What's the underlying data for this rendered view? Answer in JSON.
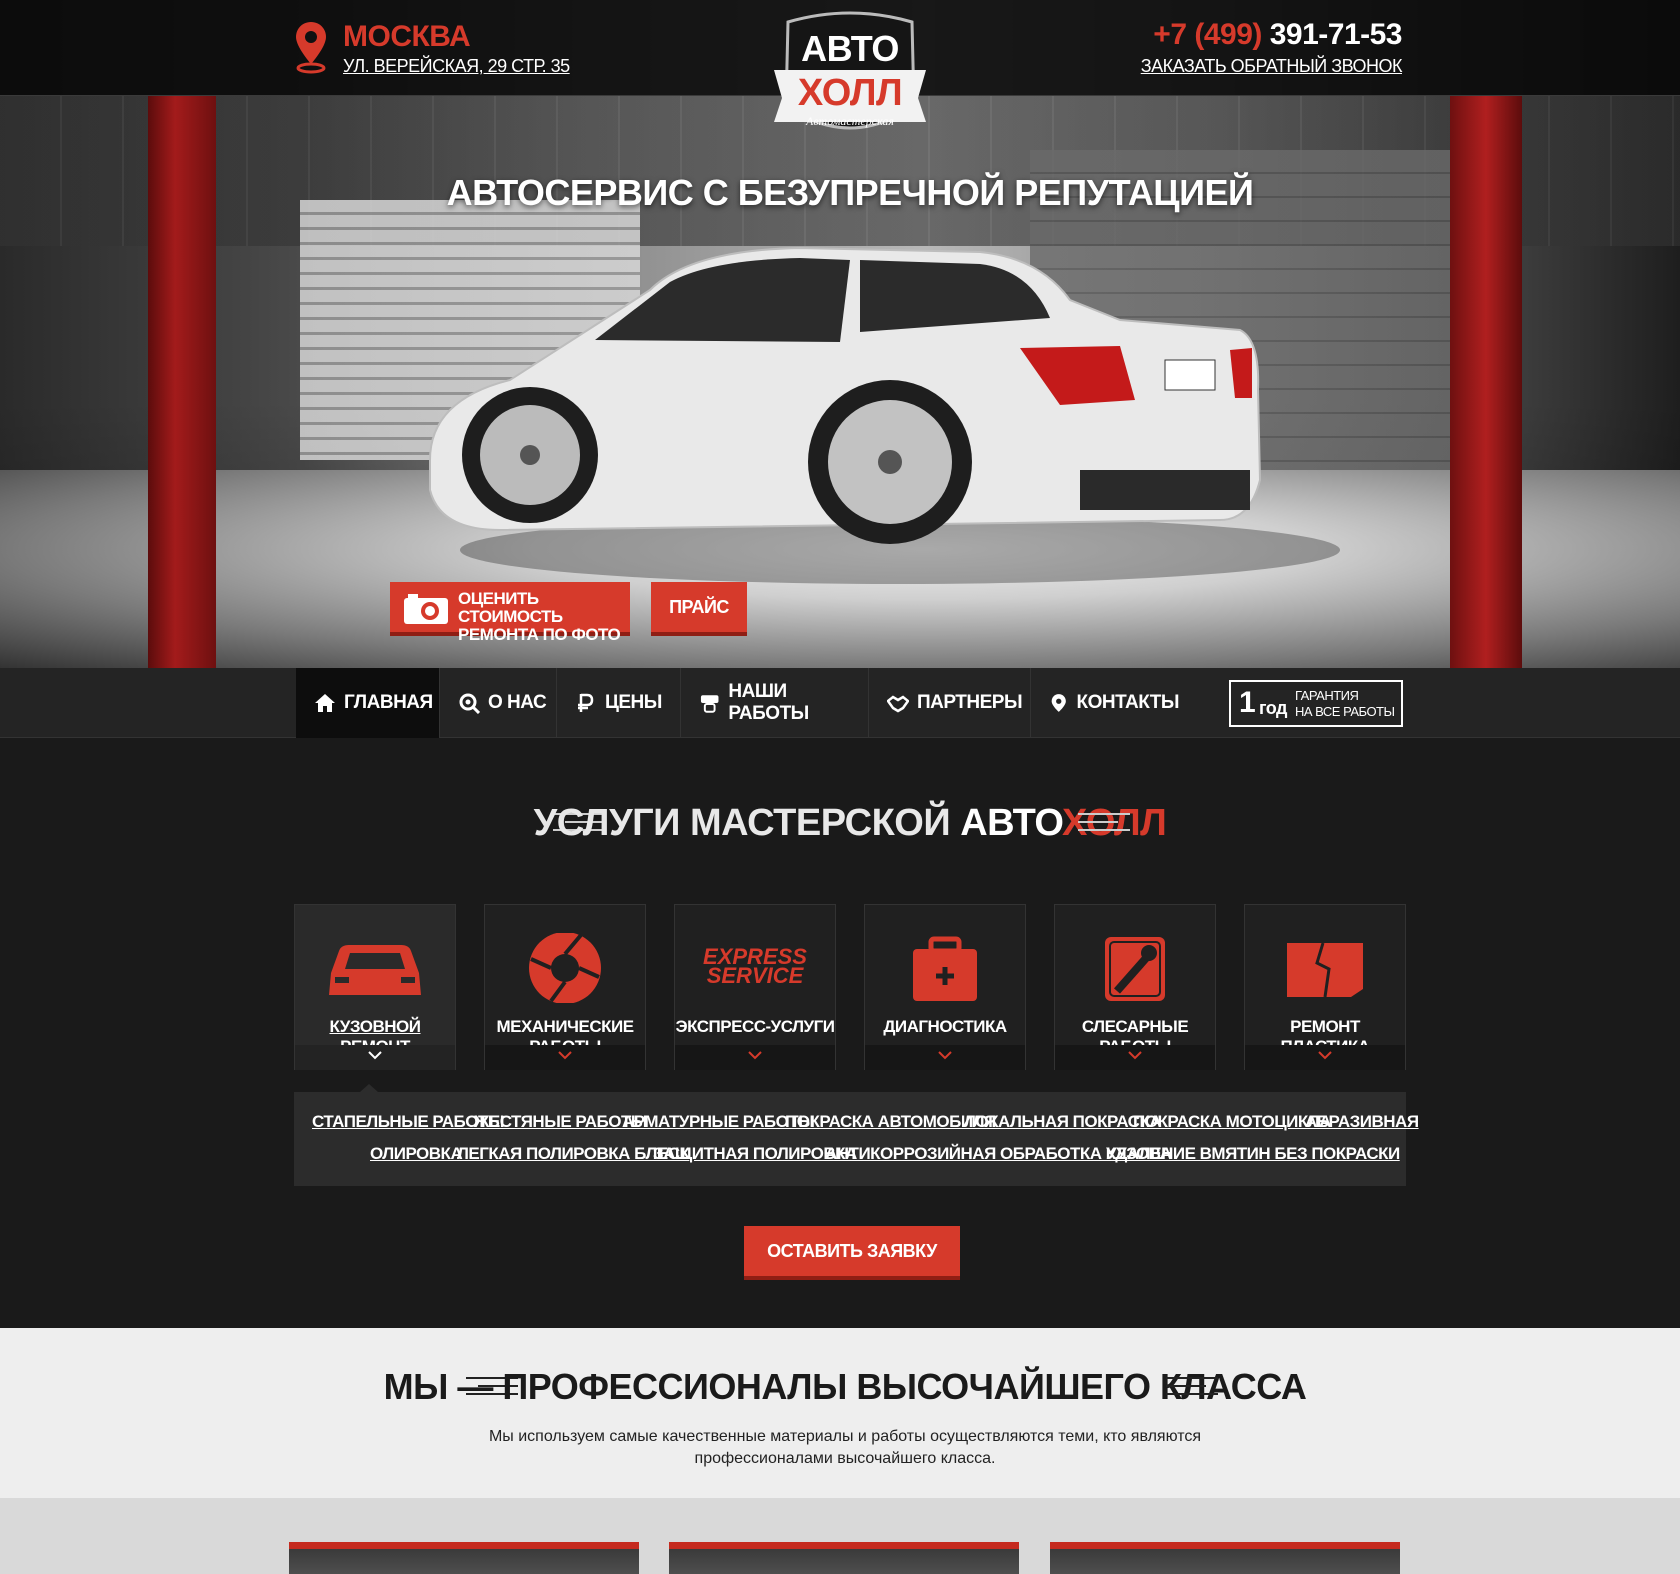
{
  "header": {
    "city": "МОСКВА",
    "address": "УЛ. ВЕРЕЙСКАЯ, 29 СТР. 35",
    "logo_line1": "АВТО",
    "logo_line2": "ХОЛЛ",
    "logo_line3": "Автомастерская",
    "phone_code": "+7 (499)",
    "phone_number": "391-71-53",
    "callback_label": "ЗАКАЗАТЬ ОБРАТНЫЙ ЗВОНОК"
  },
  "hero": {
    "title": "АВТОСЕРВИС С БЕЗУПРЕЧНОЙ РЕПУТАЦИЕЙ",
    "photo_button_line1": "ОЦЕНИТЬ СТОИМОСТЬ",
    "photo_button_line2": "РЕМОНТА ПО ФОТО",
    "price_button": "ПРАЙС"
  },
  "nav": {
    "items": [
      {
        "label": "ГЛАВНАЯ",
        "icon": "home-icon"
      },
      {
        "label": "О НАС",
        "icon": "search-gear-icon"
      },
      {
        "label": "ЦЕНЫ",
        "icon": "ruble-icon"
      },
      {
        "label": "НАШИ РАБОТЫ",
        "icon": "wheel-icon"
      },
      {
        "label": "ПАРТНЕРЫ",
        "icon": "handshake-icon"
      },
      {
        "label": "КОНТАКТЫ",
        "icon": "pin-icon"
      }
    ],
    "guarantee_number": "1",
    "guarantee_unit": "год",
    "guarantee_line1": "ГАРАНТИЯ",
    "guarantee_line2": "НА ВСЕ РАБОТЫ"
  },
  "services": {
    "title_part1": "УСЛУГИ МАСТЕРСКОЙ ",
    "title_part2": "АВТО",
    "title_part3": "ХОЛЛ",
    "cards": [
      {
        "label": "КУЗОВНОЙ РЕМОНТ",
        "icon": "car-icon"
      },
      {
        "label": "МЕХАНИЧЕСКИЕ РАБОТЫ",
        "icon": "gear-aperture-icon"
      },
      {
        "label": "ЭКСПРЕСС-УСЛУГИ",
        "icon": "express-service-icon"
      },
      {
        "label": "ДИАГНОСТИКА",
        "icon": "medkit-icon"
      },
      {
        "label": "СЛЕСАРНЫЕ РАБОТЫ",
        "icon": "wrench-icon"
      },
      {
        "label": "РЕМОНТ ПЛАСТИКА",
        "icon": "cracked-plastic-icon"
      }
    ],
    "express_line1": "EXPRESS",
    "express_line2": "SERVICE",
    "sublinks_row1": [
      "СТАПЕЛЬНЫЕ РАБОТЫ",
      "ЖЕСТЯНЫЕ РАБОТЫ",
      "АРМАТУРНЫЕ РАБОТЫ",
      "ПОКРАСКА АВТОМОБИЛЯ",
      "ЛОКАЛЬНАЯ ПОКРАСКА",
      "ПОКРАСКА МОТОЦИКЛА",
      "АБРАЗИВНАЯ"
    ],
    "sublinks_row2": [
      "ОЛИРОВКА",
      "ЛЕГКАЯ ПОЛИРОВКА БЛЕСК",
      "ЗАЩИТНАЯ ПОЛИРОВКА",
      "АНТИКОРРОЗИЙНАЯ ОБРАБОТКА КУЗОВА",
      "УДАЛЕНИЕ ВМЯТИН БЕЗ ПОКРАСКИ"
    ],
    "order_button": "ОСТАВИТЬ ЗАЯВКУ"
  },
  "pro": {
    "title": "МЫ — ПРОФЕССИОНАЛЫ ВЫСОЧАЙШЕГО КЛАССА",
    "text": "Мы используем самые качественные материалы и работы осуществляются теми, кто являются профессионалами высочайшего класса."
  },
  "colors": {
    "accent": "#d63a2b",
    "dark": "#1a1a1a",
    "light": "#eeeeee"
  }
}
